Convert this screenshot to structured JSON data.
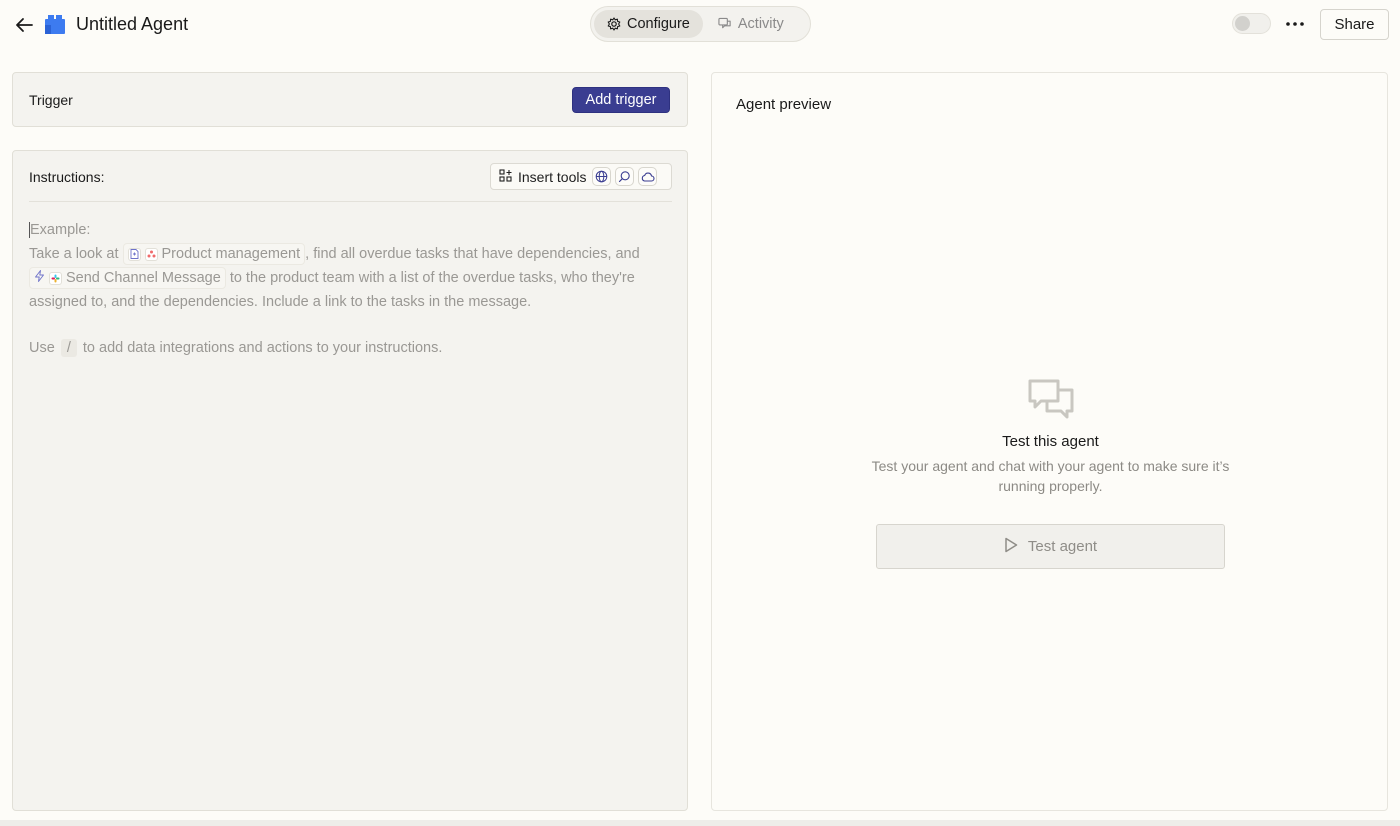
{
  "header": {
    "title": "Untitled Agent",
    "tabs": [
      {
        "label": "Configure",
        "icon": "gear-icon",
        "active": true
      },
      {
        "label": "Activity",
        "icon": "chat-bubbles-icon",
        "active": false
      }
    ],
    "share_label": "Share",
    "toggle_on": false
  },
  "trigger": {
    "label": "Trigger",
    "button_label": "Add trigger"
  },
  "instructions": {
    "label": "Instructions:",
    "insert_tools_label": "Insert tools",
    "tool_icons": [
      "globe-icon",
      "search-icon",
      "cloud-icon"
    ],
    "example_title": "Example:",
    "example_part1": "Take a look at",
    "chip1_label": "Product management",
    "example_part2": ", find all overdue tasks that have dependencies, and",
    "chip2_label": "Send Channel Message",
    "example_part3": "to the product team with a list of the overdue tasks, who they're assigned to, and the dependencies. Include a link to the tasks in the message.",
    "hint_before": "Use",
    "hint_key": "/",
    "hint_after": "to add data integrations and actions to your instructions."
  },
  "preview": {
    "title": "Agent preview",
    "empty_title": "Test this agent",
    "empty_subtitle": "Test your agent and chat with your agent to make sure it’s running properly.",
    "test_button_label": "Test agent"
  },
  "colors": {
    "accent": "#3a3d91",
    "background": "#fdfcf8",
    "card": "#f4f3ef",
    "logo": "#3d7bf0"
  }
}
